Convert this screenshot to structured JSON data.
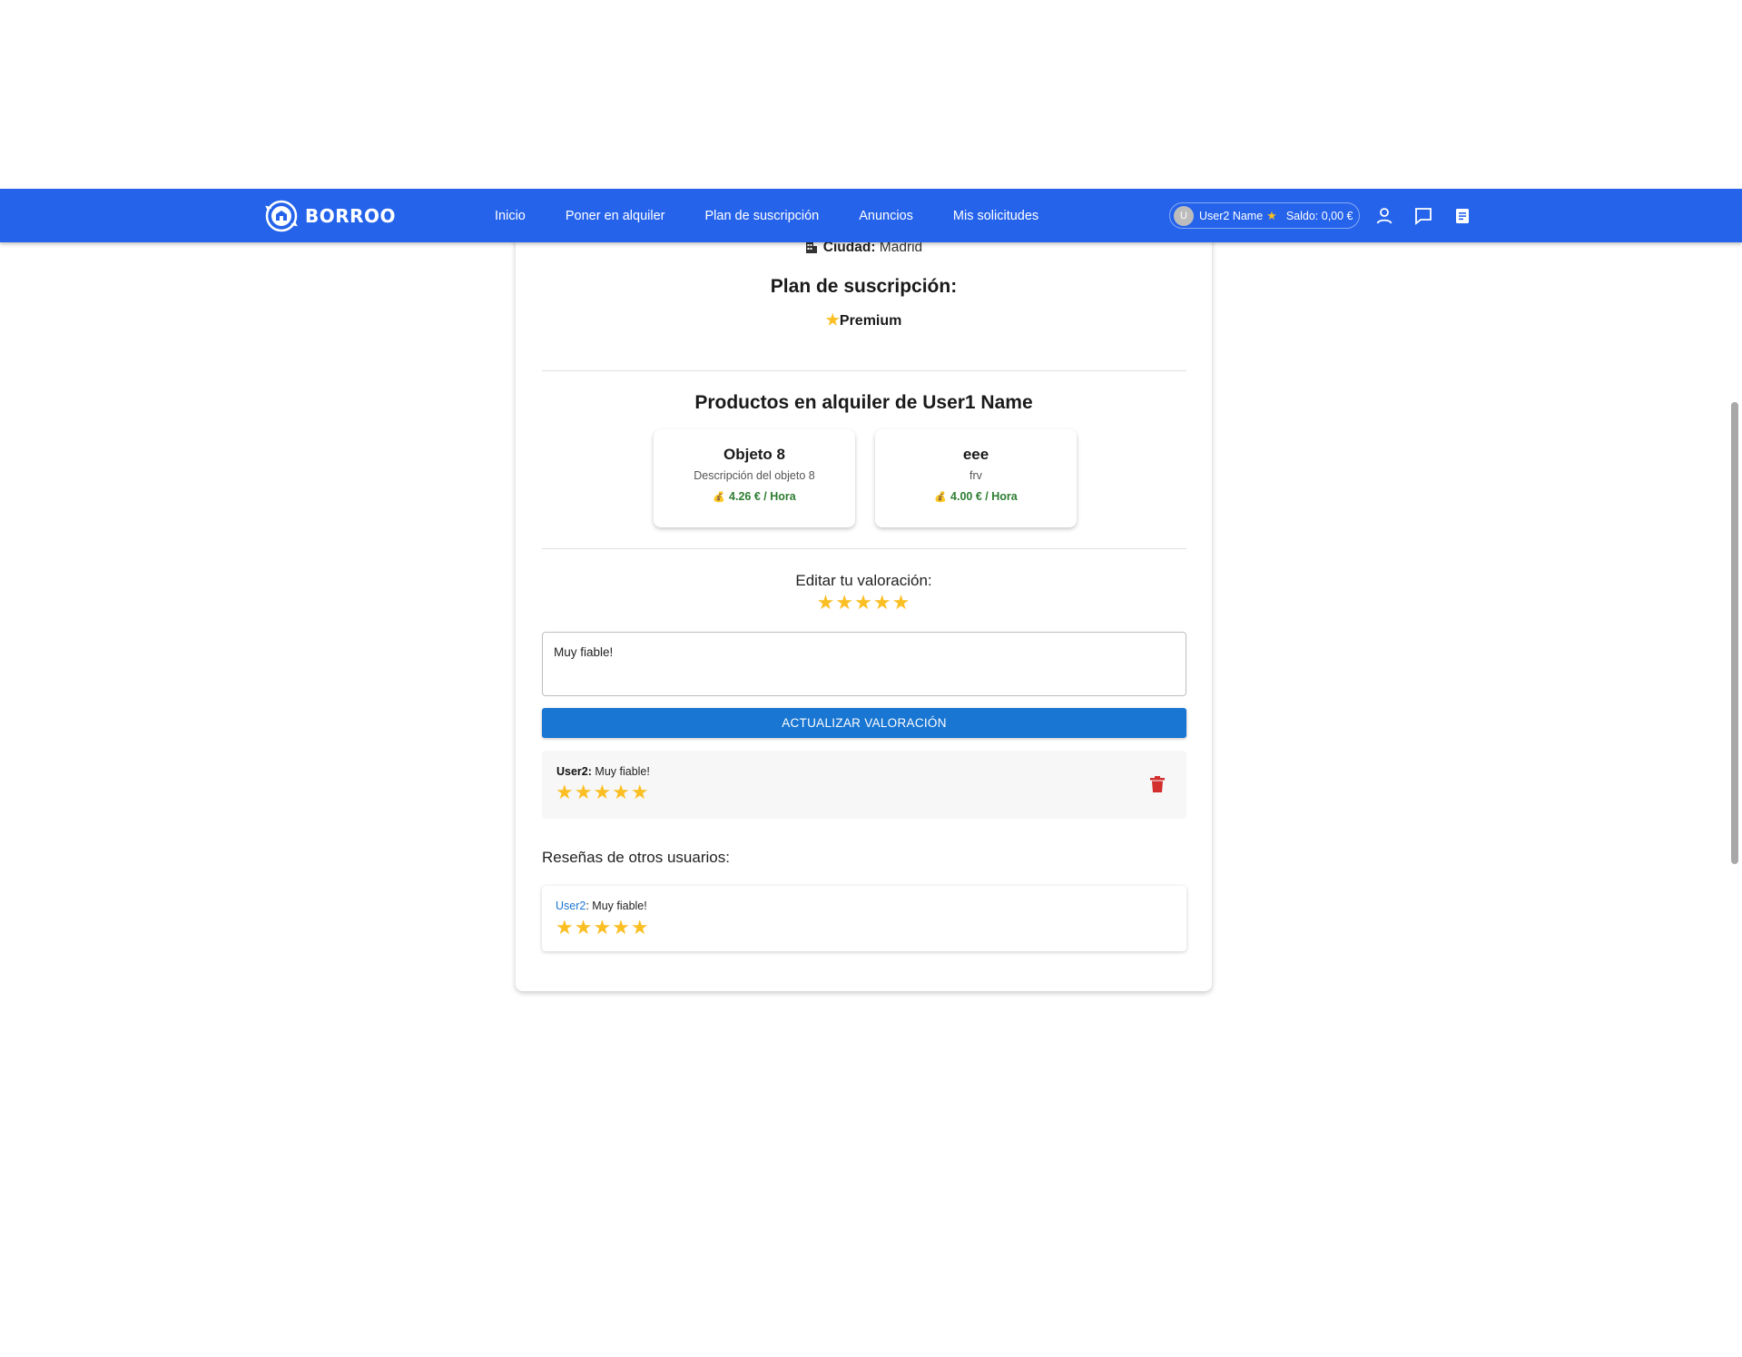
{
  "header": {
    "brand": "BORROO",
    "nav": [
      "Inicio",
      "Poner en alquiler",
      "Plan de suscripción",
      "Anuncios",
      "Mis solicitudes"
    ],
    "user": {
      "avatar_initial": "U",
      "name": "User2 Name",
      "balance": "Saldo: 0,00 €"
    },
    "icons": [
      "person-icon",
      "chat-icon",
      "document-icon"
    ],
    "colors": {
      "bar": "#2563eb",
      "star": "#fbbf24"
    }
  },
  "profile": {
    "city_label": "Ciudad:",
    "city_value": "Madrid",
    "plan_title": "Plan de suscripción:",
    "plan_value": "Premium"
  },
  "products": {
    "title": "Productos en alquiler de User1 Name",
    "items": [
      {
        "name": "Objeto 8",
        "description": "Descripción del objeto 8",
        "price": "4.26 € / Hora"
      },
      {
        "name": "eee",
        "description": "frv",
        "price": "4.00 € / Hora"
      }
    ]
  },
  "rating": {
    "label": "Editar tu valoración:",
    "stars": 5,
    "stars_max": 5,
    "comment": "Muy fiable!",
    "button": "ACTUALIZAR VALORACIÓN"
  },
  "my_review": {
    "user": "User2:",
    "text": "Muy fiable!",
    "stars": 5
  },
  "others": {
    "title": "Reseñas de otros usuarios:",
    "reviews": [
      {
        "user": "User2",
        "text": ": Muy fiable!",
        "stars": 5
      }
    ]
  }
}
